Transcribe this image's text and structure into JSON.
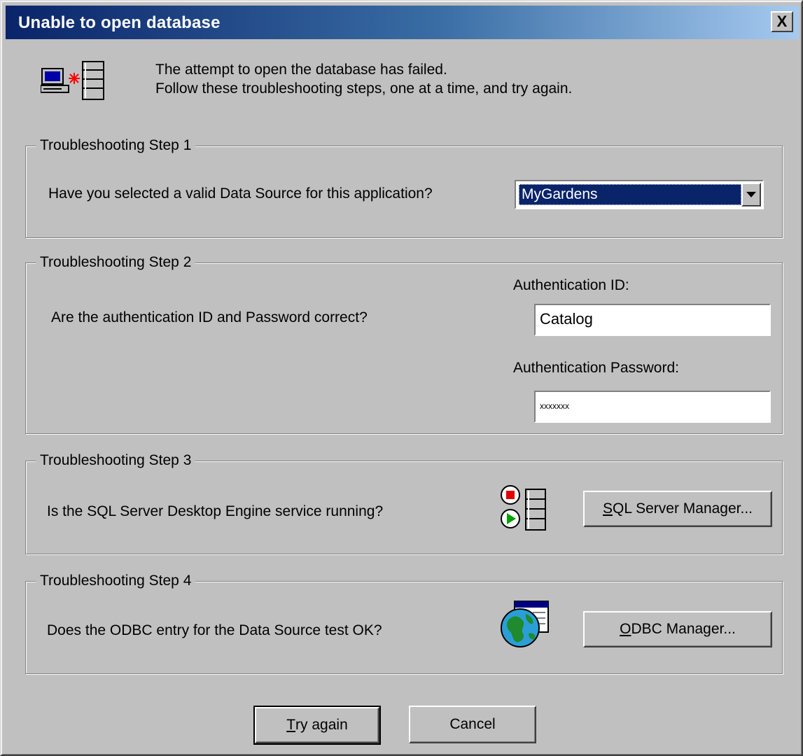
{
  "window": {
    "title": "Unable to open database",
    "close_label": "X"
  },
  "intro": {
    "line1": "The attempt to open the database has failed.",
    "line2": "Follow these troubleshooting steps, one at a time, and try again."
  },
  "step1": {
    "legend": "Troubleshooting Step 1",
    "question": "Have you selected a valid Data Source for this application?",
    "data_source_value": "MyGardens"
  },
  "step2": {
    "legend": "Troubleshooting Step 2",
    "question": "Are the authentication ID and Password correct?",
    "id_label": "Authentication ID:",
    "id_value": "Catalog",
    "password_label": "Authentication Password:",
    "password_value": "xxxxxxx"
  },
  "step3": {
    "legend": "Troubleshooting Step 3",
    "question": "Is the SQL Server Desktop Engine service running?",
    "button_mnemonic": "S",
    "button_rest": "QL Server Manager..."
  },
  "step4": {
    "legend": "Troubleshooting Step 4",
    "question": "Does the ODBC entry for the Data Source test OK?",
    "button_mnemonic": "O",
    "button_rest": "DBC Manager..."
  },
  "footer": {
    "try_again_mnemonic": "T",
    "try_again_rest": "ry again",
    "cancel_label": "Cancel"
  },
  "icons": {
    "header": "database-connection-error-icon",
    "step3": "service-start-stop-icon",
    "step4": "odbc-globe-icon"
  }
}
